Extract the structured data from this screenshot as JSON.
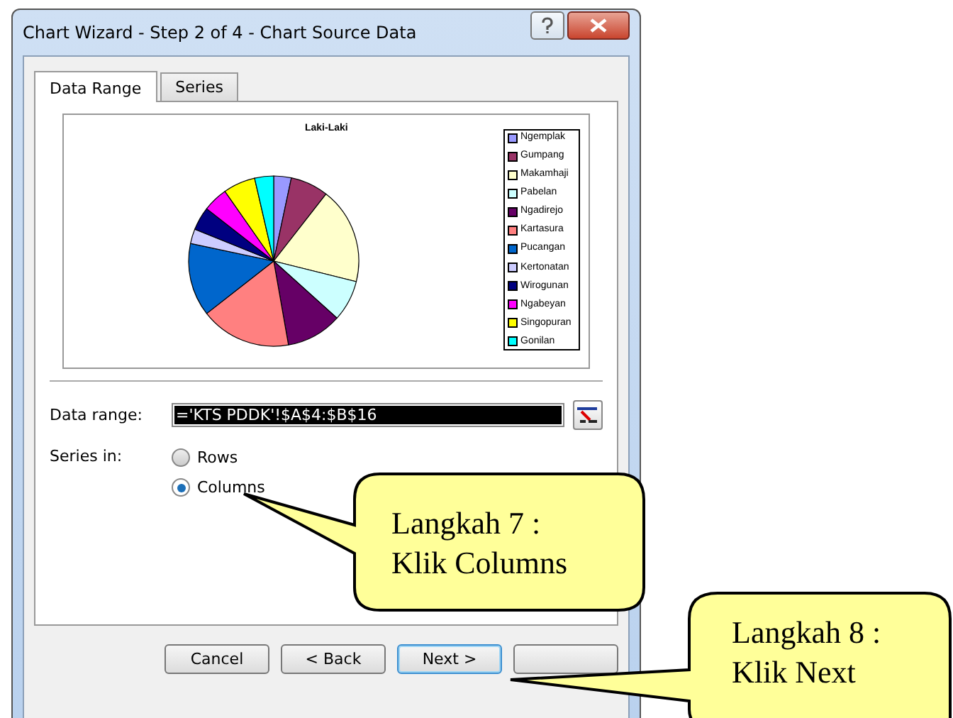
{
  "window": {
    "title": "Chart Wizard - Step 2 of 4 - Chart Source Data"
  },
  "tabs": [
    {
      "label": "Data Range",
      "selected": true
    },
    {
      "label": "Series",
      "selected": false
    }
  ],
  "chart": {
    "title": "Laki-Laki",
    "legend": [
      {
        "label": "Ngemplak",
        "color": "#9999ff"
      },
      {
        "label": "Gumpang",
        "color": "#993366"
      },
      {
        "label": "Makamhaji",
        "color": "#ffffcc"
      },
      {
        "label": "Pabelan",
        "color": "#ccffff"
      },
      {
        "label": "Ngadirejo",
        "color": "#660066"
      },
      {
        "label": "Kartasura",
        "color": "#ff8080"
      },
      {
        "label": "Pucangan",
        "color": "#0066cc"
      },
      {
        "label": "Kertonatan",
        "color": "#ccccff"
      },
      {
        "label": "Wirogunan",
        "color": "#000080"
      },
      {
        "label": "Ngabeyan",
        "color": "#ff00ff"
      },
      {
        "label": "Singopuran",
        "color": "#ffff00"
      },
      {
        "label": "Gonilan",
        "color": "#00ffff"
      }
    ]
  },
  "data_range": {
    "label": "Data range:",
    "value": "='KTS PDDK'!$A$4:$B$16"
  },
  "series_in": {
    "label": "Series in:",
    "options": [
      {
        "label": "Rows",
        "selected": false
      },
      {
        "label": "Columns",
        "selected": true
      }
    ]
  },
  "buttons": [
    {
      "label": "Cancel",
      "focused": false
    },
    {
      "label": "< Back",
      "focused": false
    },
    {
      "label": "Next >",
      "focused": true
    },
    {
      "focused": false
    }
  ],
  "callouts": [
    {
      "lines": [
        "Langkah 7 :",
        "Klik Columns"
      ]
    },
    {
      "lines": [
        "Langkah 8 :",
        "Klik Next"
      ]
    }
  ]
}
